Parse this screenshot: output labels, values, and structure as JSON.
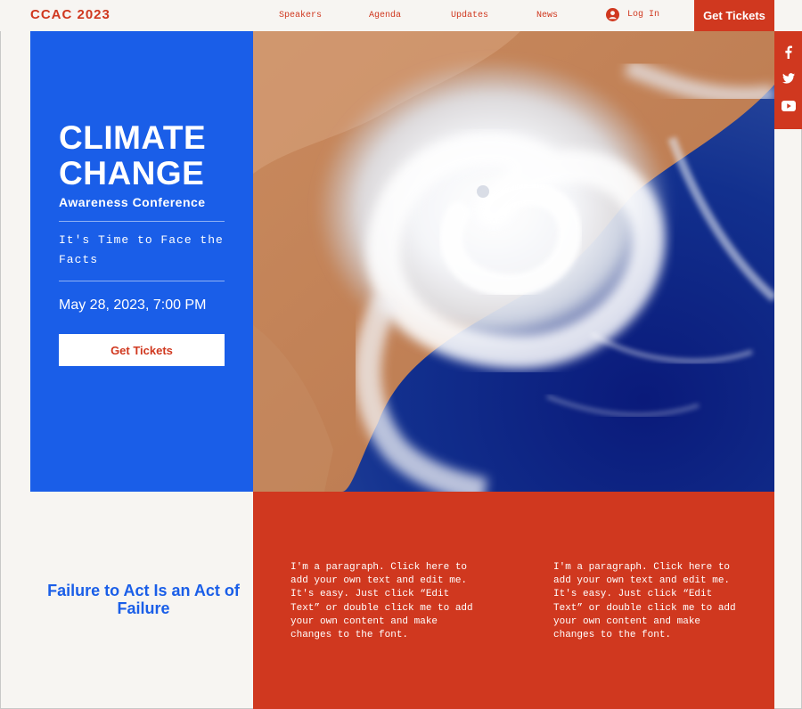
{
  "header": {
    "logo": "CCAC 2023",
    "nav": [
      {
        "label": "Speakers"
      },
      {
        "label": "Agenda"
      },
      {
        "label": "Updates"
      },
      {
        "label": "News"
      }
    ],
    "login_label": "Log In",
    "tickets_label": "Get Tickets"
  },
  "social": [
    {
      "icon": "facebook-icon"
    },
    {
      "icon": "twitter-icon"
    },
    {
      "icon": "youtube-icon"
    }
  ],
  "hero": {
    "title_line1": "CLIMATE",
    "title_line2": "CHANGE",
    "subtitle": "Awareness Conference",
    "tagline": "It's Time to Face the Facts",
    "date": "May 28, 2023, 7:00 PM",
    "cta_label": "Get Tickets",
    "image": "hurricane-satellite-image"
  },
  "section": {
    "motto": "Failure to Act Is an Act of Failure",
    "paragraph_1": "I'm a paragraph. Click here to add your own text and edit me. It's easy. Just click “Edit Text” or double click me to add your own content and make changes to the font.",
    "paragraph_2": "I'm a paragraph. Click here to add your own text and edit me. It's easy. Just click “Edit Text” or double click me to add your own content and make changes to the font."
  },
  "colors": {
    "accent_red": "#d0381f",
    "accent_blue": "#1a5ee8",
    "background": "#f7f5f2"
  }
}
